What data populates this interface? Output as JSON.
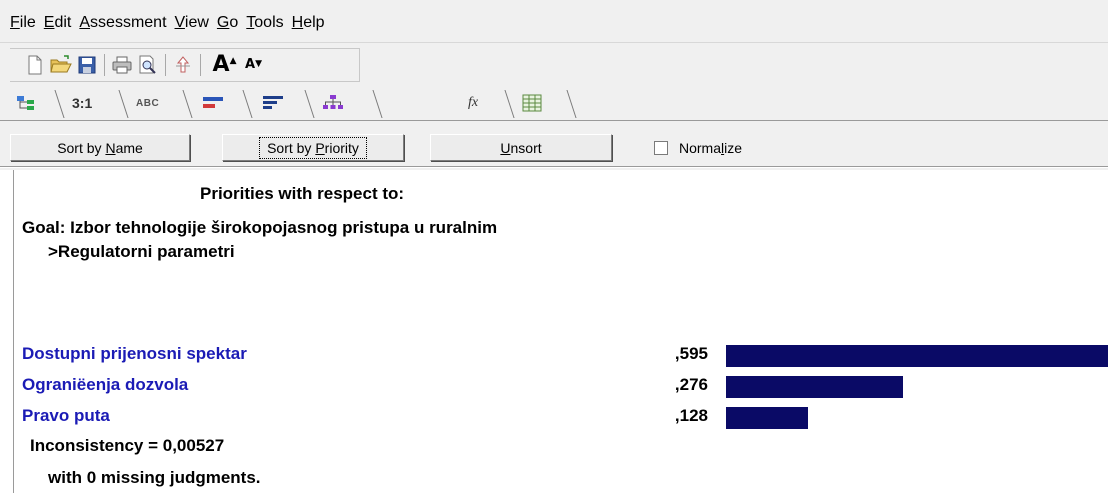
{
  "menu": [
    {
      "ul": "F",
      "rest": "ile"
    },
    {
      "ul": "E",
      "rest": "dit"
    },
    {
      "ul": "A",
      "rest": "ssessment"
    },
    {
      "ul": "V",
      "rest": "iew"
    },
    {
      "ul": "G",
      "rest": "o"
    },
    {
      "ul": "T",
      "rest": "ools"
    },
    {
      "ul": "H",
      "rest": "elp"
    }
  ],
  "toolbar": {
    "icons": [
      "new-document-icon",
      "open-folder-icon",
      "save-disk-icon",
      "print-icon",
      "print-preview-icon",
      "move-up-icon"
    ],
    "font_big_label": "A",
    "font_small_label": "A"
  },
  "tabs": [
    {
      "name": "tree-view-icon"
    },
    {
      "text": "3:1"
    },
    {
      "text": "ABC"
    },
    {
      "name": "bar-graph-icon"
    },
    {
      "name": "priority-bars-icon"
    },
    {
      "name": "hierarchy-icon"
    },
    {
      "text": "fx"
    },
    {
      "name": "spreadsheet-icon"
    }
  ],
  "sort": {
    "by_name_pre": "Sort by ",
    "by_name_ul": "N",
    "by_name_post": "ame",
    "by_priority_pre": "Sort by ",
    "by_priority_ul": "P",
    "by_priority_post": "riority",
    "unsort_ul": "U",
    "unsort_post": "nsort",
    "normalize_pre": "Norma",
    "normalize_ul": "l",
    "normalize_post": "ize",
    "normalize_checked": false
  },
  "results": {
    "heading": "Priorities with respect to:",
    "goal": "Goal: Izbor tehnologije širokopojasnog pristupa u ruralnim",
    "sub": ">Regulatorni parametri",
    "max_value": 0.595,
    "rows": [
      {
        "name": "Dostupni prijenosni spektar",
        "value_label": ",595",
        "value": 0.595
      },
      {
        "name": "Ograniëenja dozvola",
        "value_label": ",276",
        "value": 0.276
      },
      {
        "name": "Pravo puta",
        "value_label": ",128",
        "value": 0.128
      }
    ],
    "inconsistency": "Inconsistency = 0,00527",
    "missing": "with 0  missing judgments."
  },
  "colors": {
    "bar": "#0a0a66",
    "item_text": "#1b1bb5",
    "chrome_bg": "#f0f0f0"
  }
}
